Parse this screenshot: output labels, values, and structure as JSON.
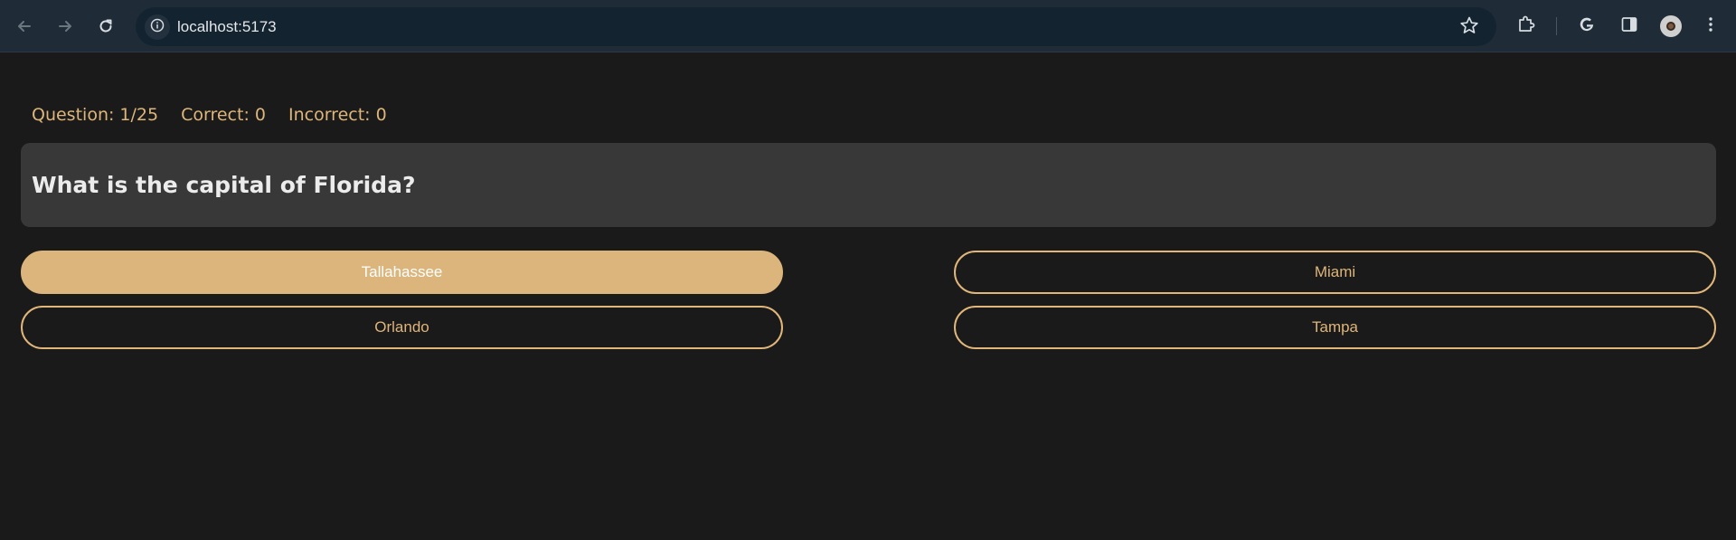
{
  "browser": {
    "url": "localhost:5173",
    "icons": {
      "back": "arrow-left-icon",
      "forward": "arrow-right-icon",
      "reload": "reload-icon",
      "site_info": "info-icon",
      "bookmark": "star-icon",
      "extensions": "puzzle-icon",
      "google": "google-icon",
      "side_panel": "side-panel-icon",
      "profile": "avatar",
      "menu": "kebab-menu-icon"
    }
  },
  "quiz": {
    "stats": {
      "question": "Question: 1/25",
      "correct": "Correct: 0",
      "incorrect": "Incorrect: 0"
    },
    "question": "What is the capital of Florida?",
    "answers": [
      {
        "label": "Tallahassee",
        "selected": true
      },
      {
        "label": "Miami",
        "selected": false
      },
      {
        "label": "Orlando",
        "selected": false
      },
      {
        "label": "Tampa",
        "selected": false
      }
    ]
  },
  "colors": {
    "page_background": "#1a1a1a",
    "chrome_background": "#1f2c37",
    "accent": "#deb57a",
    "card_background": "#383838",
    "question_text": "#ececec"
  }
}
